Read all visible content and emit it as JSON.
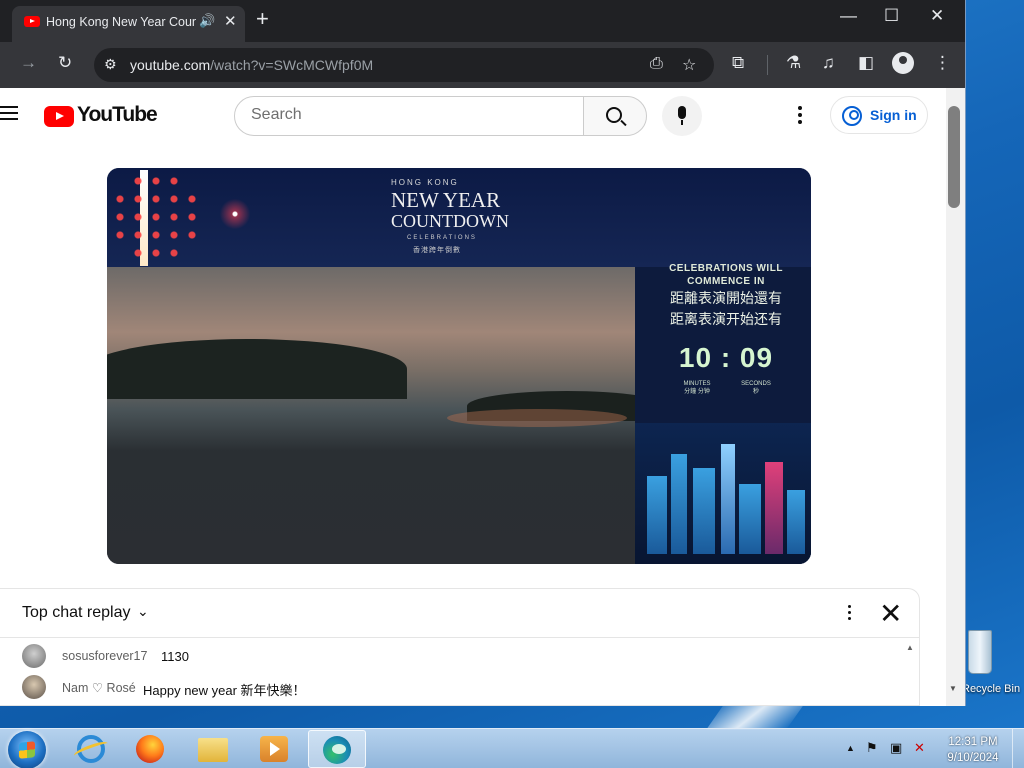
{
  "browser": {
    "tab_title": "Hong Kong New Year Countdown",
    "url_host": "youtube.com",
    "url_path": "/watch?v=SWcMCWfpf0M"
  },
  "youtube": {
    "logo_text": "YouTube",
    "search_placeholder": "Search",
    "sign_in_label": "Sign in"
  },
  "video": {
    "hk_small": "HONG KONG",
    "title_line1": "NEW YEAR",
    "title_line2": "COUNTDOWN",
    "celebrations_sub": "CELEBRATIONS",
    "hk_zh": "香港跨年倒數",
    "commence_en": "CELEBRATIONS WILL COMMENCE IN",
    "commence_zh_trad": "距離表演開始還有",
    "commence_zh_simp": "距离表演开始还有",
    "countdown": "10 : 09",
    "minutes_label": "MINUTES",
    "minutes_zh": "分鐘 分钟",
    "seconds_label": "SECONDS",
    "seconds_zh": "秒"
  },
  "chat": {
    "title": "Top chat replay",
    "messages": [
      {
        "author": "sosusforever17",
        "text": "1130"
      },
      {
        "author": "Nam ♡ Rosé",
        "text": "Happy new year 新年快樂！"
      }
    ]
  },
  "desktop": {
    "recycle_label": "Recycle Bin"
  },
  "taskbar": {
    "time": "12:31 PM",
    "date": "9/10/2024"
  }
}
